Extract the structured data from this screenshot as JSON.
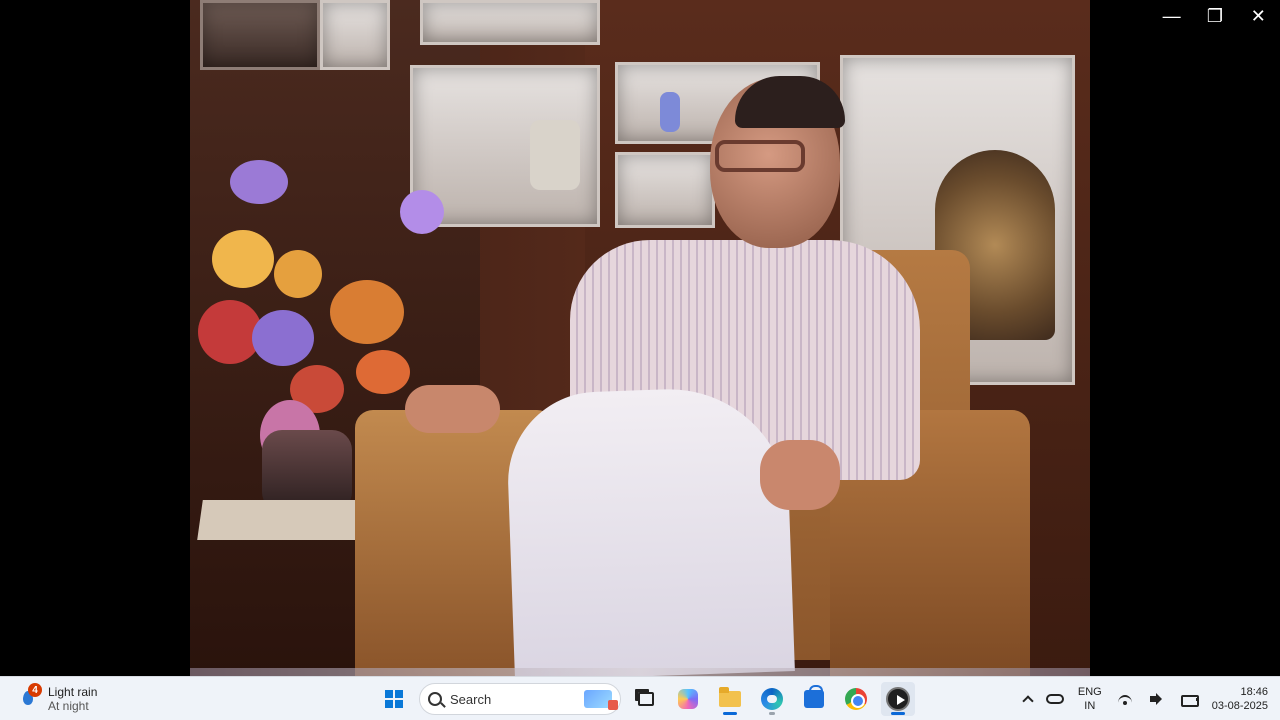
{
  "window": {
    "controls": {
      "minimize": "—",
      "restore": "❐",
      "close": "✕"
    }
  },
  "taskbar": {
    "weather": {
      "badge_count": "4",
      "condition": "Light rain",
      "time_of_day": "At night"
    },
    "search": {
      "label": "Search"
    },
    "tray": {
      "language_primary": "ENG",
      "language_secondary": "IN",
      "time": "18:46",
      "date": "03-08-2025"
    },
    "pinned_apps": [
      "start-icon",
      "search-icon",
      "task-view-icon",
      "copilot-icon",
      "file-explorer-icon",
      "edge-icon",
      "store-icon",
      "chrome-icon",
      "media-player-icon"
    ]
  },
  "colors": {
    "taskbar_bg": "#eff3f9",
    "accent": "#0a78d7",
    "badge": "#d83b01"
  }
}
